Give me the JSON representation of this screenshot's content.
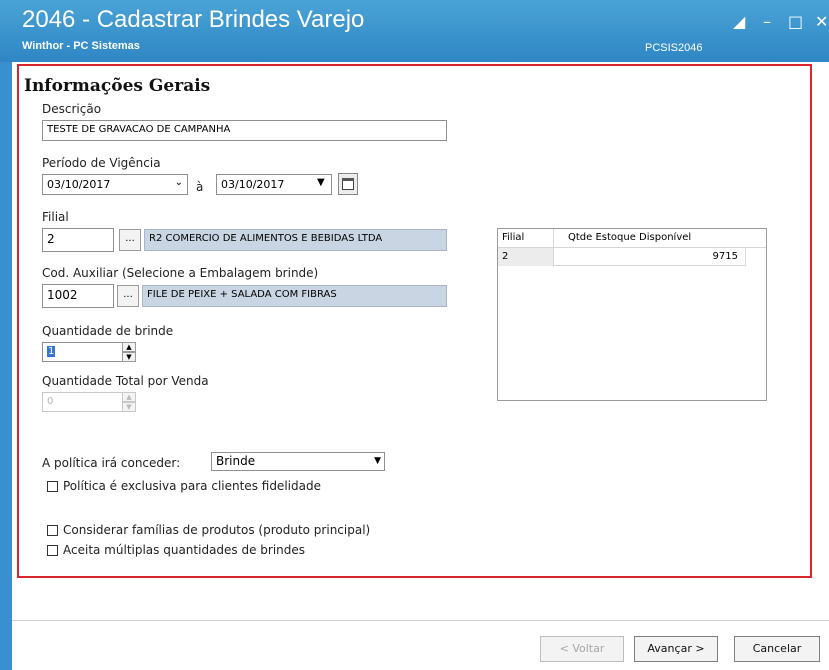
{
  "window": {
    "title": "2046 - Cadastrar Brindes Varejo",
    "subtitle": "Winthor - PC Sistemas",
    "code": "PCSIS2046"
  },
  "section_title": "Informações Gerais",
  "descricao": {
    "label": "Descrição",
    "value": "TESTE DE GRAVACAO DE CAMPANHA"
  },
  "periodo": {
    "label": "Período de Vigência",
    "start": "03/10/2017",
    "separator": "à",
    "end": "03/10/2017"
  },
  "filial": {
    "label": "Filial",
    "code": "2",
    "name": "R2 COMERCIO DE ALIMENTOS E BEBIDAS LTDA"
  },
  "cod_auxiliar": {
    "label": "Cod. Auxiliar (Selecione a Embalagem brinde)",
    "code": "1002",
    "name": "FILE DE PEIXE + SALADA COM FIBRAS"
  },
  "lookup_button": "...",
  "quantidade_brinde": {
    "label": "Quantidade de brinde",
    "value": "1"
  },
  "quantidade_total": {
    "label": "Quantidade Total por Venda",
    "value": "0"
  },
  "politica": {
    "label": "A política irá conceder:",
    "value": "Brinde"
  },
  "checkboxes": {
    "fidelidade": "Política é exclusiva para clientes fidelidade",
    "familias": "Considerar famílias de produtos (produto principal)",
    "multiplas": "Aceita múltiplas quantidades de brindes"
  },
  "grid": {
    "columns": [
      "Filial",
      "Qtde Estoque Disponível"
    ],
    "rows": [
      [
        "2",
        "9715"
      ]
    ]
  },
  "buttons": {
    "voltar": "< Voltar",
    "avancar": "Avançar >",
    "cancelar": "Cancelar"
  }
}
